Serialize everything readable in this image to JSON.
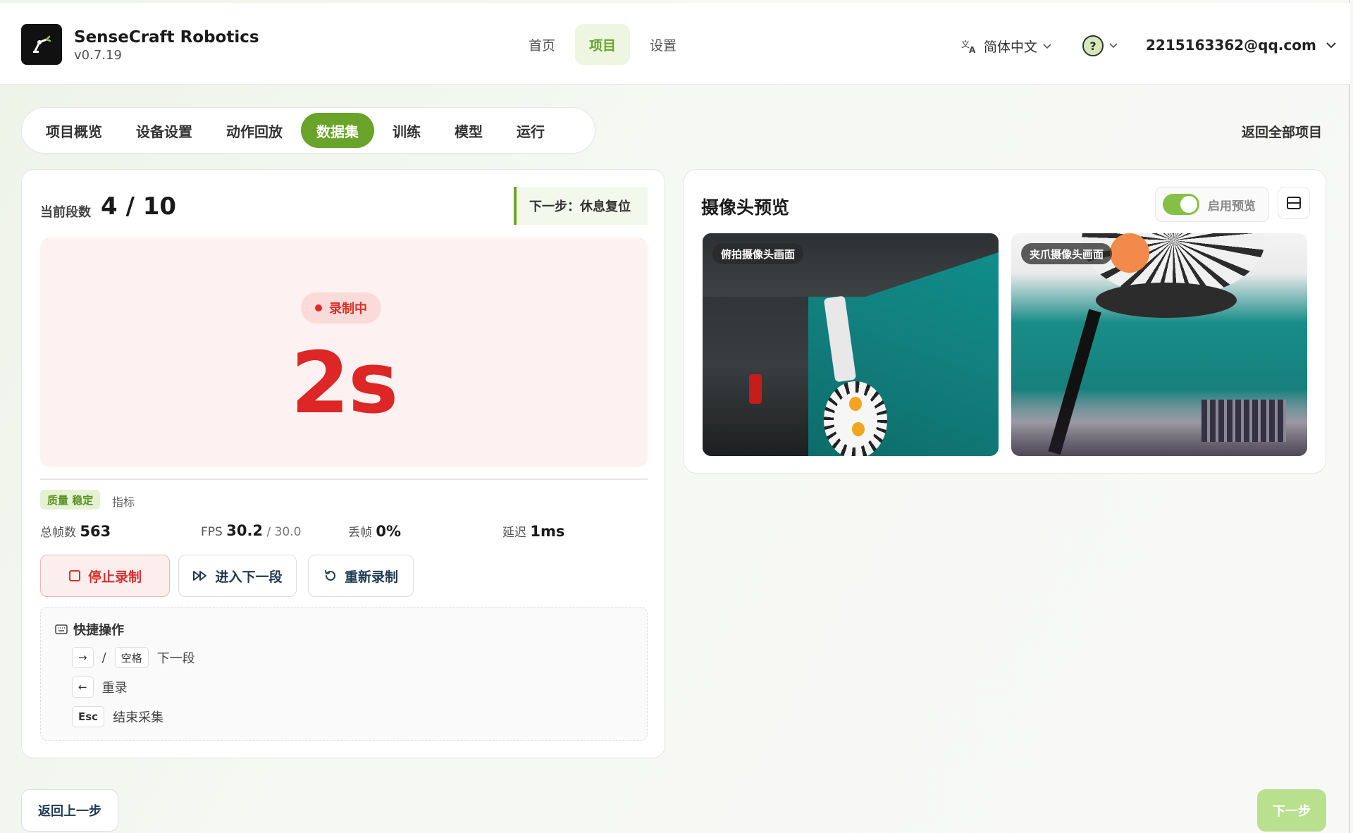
{
  "brand": {
    "name": "SenseCraft Robotics",
    "version": "v0.7.19"
  },
  "top_nav": {
    "items": [
      "首页",
      "项目",
      "设置"
    ],
    "active": "项目"
  },
  "header": {
    "language": "简体中文",
    "user_email": "2215163362@qq.com"
  },
  "sub_tabs": {
    "items": [
      "项目概览",
      "设备设置",
      "动作回放",
      "数据集",
      "训练",
      "模型",
      "运行"
    ],
    "active": "数据集"
  },
  "back_all_projects": "返回全部项目",
  "recording": {
    "segment_label": "当前段数",
    "segment_value": "4 / 10",
    "next_step": "下一步：休息复位",
    "status": "录制中",
    "timer": "2s",
    "quality_badge": "质量 稳定",
    "metric_label": "指标",
    "stats": {
      "total_frames_label": "总帧数",
      "total_frames": "563",
      "fps_label": "FPS",
      "fps": "30.2",
      "fps_target": "/ 30.0",
      "dropped_label": "丢帧",
      "dropped": "0%",
      "latency_label": "延迟",
      "latency": "1ms"
    },
    "buttons": {
      "stop": "停止录制",
      "next_segment": "进入下一段",
      "rerecord": "重新录制"
    },
    "shortcuts": {
      "title": "快捷操作",
      "next_key_1": "→",
      "separator": "/",
      "next_key_2": "空格",
      "next_desc": "下一段",
      "redo_key": "←",
      "redo_desc": "重录",
      "end_key": "Esc",
      "end_desc": "结束采集"
    }
  },
  "camera": {
    "title": "摄像头预览",
    "toggle_label": "启用预览",
    "toggle_on": true,
    "views": [
      "俯拍摄像头画面",
      "夹爪摄像头画面"
    ]
  },
  "footer": {
    "back": "返回上一步",
    "next": "下一步"
  },
  "colors": {
    "accent": "#6aa32a",
    "recording_red": "#dd2626",
    "next_disabled": "#b8e08e"
  }
}
